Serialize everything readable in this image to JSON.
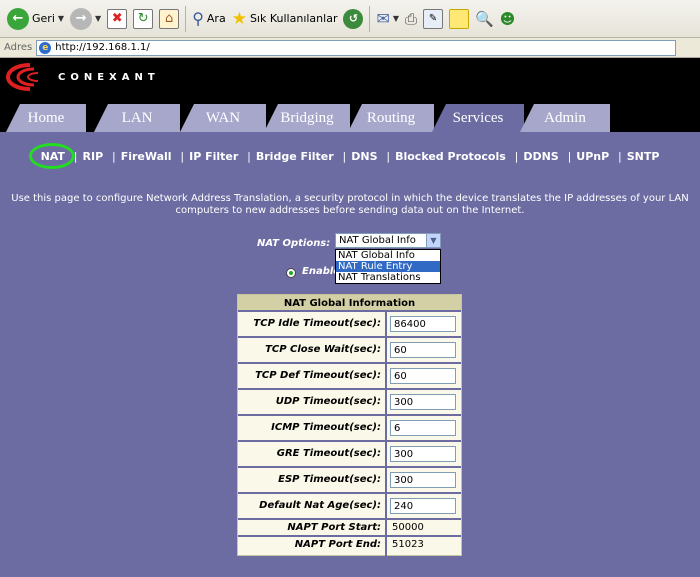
{
  "browser": {
    "toolbar": {
      "back_label": "Geri",
      "search_label": "Ara",
      "favorites_label": "Sık Kullanılanlar"
    },
    "address": {
      "label": "Adres",
      "url": "http://192.168.1.1/"
    }
  },
  "header": {
    "brand": "CONEXANT"
  },
  "tabs": [
    {
      "label": "Home"
    },
    {
      "label": "LAN"
    },
    {
      "label": "WAN"
    },
    {
      "label": "Bridging"
    },
    {
      "label": "Routing"
    },
    {
      "label": "Services",
      "active": true
    },
    {
      "label": "Admin"
    }
  ],
  "subnav": [
    "NAT",
    "RIP",
    "FireWall",
    "IP Filter",
    "Bridge Filter",
    "DNS",
    "Blocked Protocols",
    "DDNS",
    "UPnP",
    "SNTP"
  ],
  "description": "Use this page to configure Network Address Translation, a security protocol in which the device translates the IP addresses of your LAN computers to new addresses before sending data out on the Internet.",
  "nat_options": {
    "label": "NAT Options:",
    "selected": "NAT Global Info",
    "options": [
      "NAT Global Info",
      "NAT Rule Entry",
      "NAT Translations"
    ],
    "highlighted": "NAT Rule Entry"
  },
  "enable_label": "Enable",
  "table": {
    "title": "NAT Global Information",
    "fields": [
      {
        "label": "TCP Idle Timeout(sec):",
        "value": "86400"
      },
      {
        "label": "TCP Close Wait(sec):",
        "value": "60"
      },
      {
        "label": "TCP Def Timeout(sec):",
        "value": "60"
      },
      {
        "label": "UDP Timeout(sec):",
        "value": "300"
      },
      {
        "label": "ICMP Timeout(sec):",
        "value": "6"
      },
      {
        "label": "GRE Timeout(sec):",
        "value": "300"
      },
      {
        "label": "ESP Timeout(sec):",
        "value": "300"
      },
      {
        "label": "Default Nat Age(sec):",
        "value": "240"
      }
    ],
    "static_fields": [
      {
        "label": "NAPT Port Start:",
        "value": "50000"
      },
      {
        "label": "NAPT Port End:",
        "value": "51023"
      }
    ]
  },
  "colors": {
    "page_bg": "#6c6ca2",
    "tab_bg": "#a7a7cc",
    "header_bg": "#000000",
    "highlight_circle": "#22dd22"
  }
}
